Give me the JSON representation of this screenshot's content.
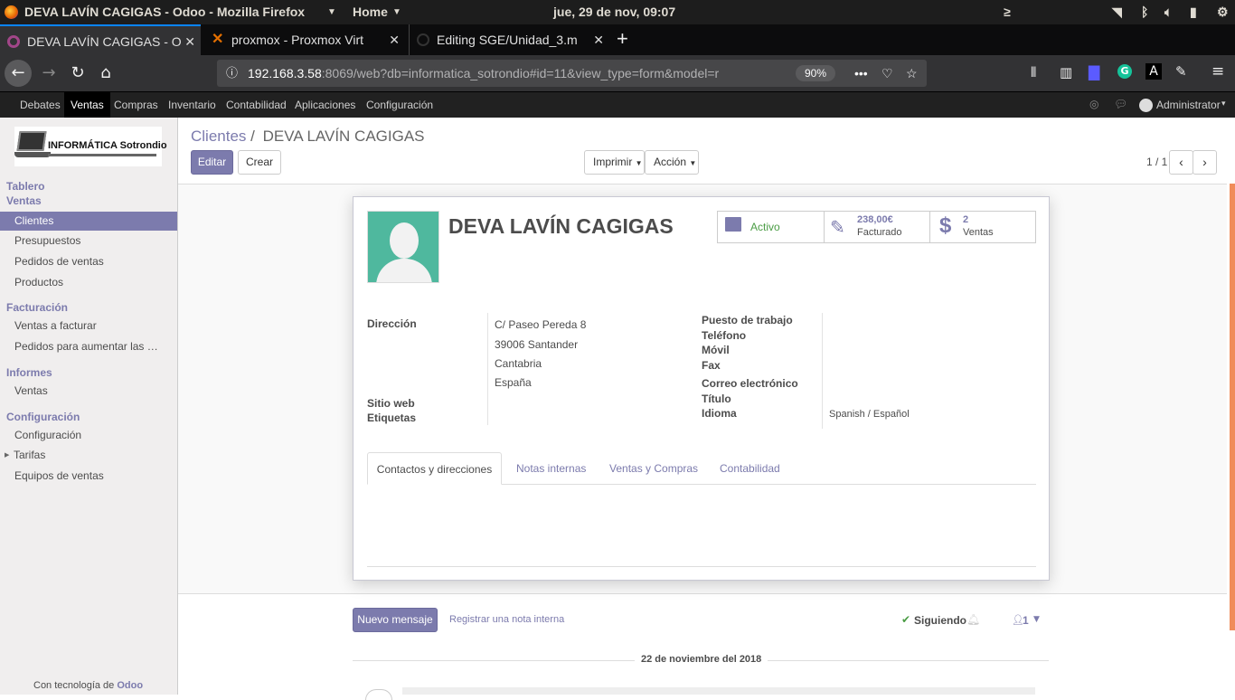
{
  "os_bar": {
    "window_title": "DEVA LAVÍN CAGIGAS - Odoo - Mozilla Firefox",
    "home": "Home",
    "clock": "jue, 29 de nov, 09:07"
  },
  "tabs": [
    {
      "title": "DEVA LAVÍN CAGIGAS - O"
    },
    {
      "title": "proxmox - Proxmox Virt"
    },
    {
      "title": "Editing SGE/Unidad_3.m"
    }
  ],
  "browser": {
    "url_host": "192.168.3.58",
    "url_rest": ":8069/web?db=informatica_sotrondio#id=11&view_type=form&model=r",
    "zoom": "90%"
  },
  "odoo_menu": {
    "items": [
      "Debates",
      "Ventas",
      "Compras",
      "Inventario",
      "Contabilidad",
      "Aplicaciones",
      "Configuración"
    ],
    "user": "Administrator"
  },
  "sidebar": {
    "logo_text": "INFORMÁTICA Sotrondio",
    "tablero": "Tablero",
    "ventas_header": "Ventas",
    "ventas_items": [
      "Clientes",
      "Presupuestos",
      "Pedidos de ventas",
      "Productos"
    ],
    "facturacion_header": "Facturación",
    "facturacion_items": [
      "Ventas a facturar",
      "Pedidos para aumentar las …"
    ],
    "informes_header": "Informes",
    "informes_items": [
      "Ventas"
    ],
    "config_header": "Configuración",
    "config_items": [
      "Configuración",
      "Tarifas",
      "Equipos de ventas"
    ],
    "powered_prefix": "Con tecnología de",
    "powered_brand": "Odoo"
  },
  "control": {
    "breadcrumb_parent": "Clientes",
    "breadcrumb_sep": "/",
    "breadcrumb_current": "DEVA LAVÍN CAGIGAS",
    "edit": "Editar",
    "create": "Crear",
    "print": "Imprimir",
    "action": "Acción",
    "pager": "1 / 1"
  },
  "record": {
    "name": "DEVA LAVÍN CAGIGAS",
    "stats": {
      "active": "Activo",
      "invoiced_value": "238,00€",
      "invoiced_label": "Facturado",
      "sales_value": "2",
      "sales_label": "Ventas"
    },
    "labels": {
      "address": "Dirección",
      "website": "Sitio web",
      "tags": "Etiquetas",
      "job": "Puesto de trabajo",
      "phone": "Teléfono",
      "mobile": "Móvil",
      "fax": "Fax",
      "email": "Correo electrónico",
      "title": "Título",
      "language": "Idioma"
    },
    "address_lines": [
      "C/ Paseo Pereda 8",
      "39006 Santander",
      "Cantabria",
      "España"
    ],
    "language": "Spanish / Español"
  },
  "notebook": {
    "tabs": [
      "Contactos y direcciones",
      "Notas internas",
      "Ventas y Compras",
      "Contabilidad"
    ]
  },
  "chatter": {
    "new_message": "Nuevo mensaje",
    "log_note": "Registrar una nota interna",
    "following": "Siguiendo",
    "followers_count": "1",
    "date_separator": "22 de noviembre del 2018"
  },
  "colors": {
    "odoo_primary": "#7c7bad",
    "avatar_bg": "#4fb89e",
    "topbar": "#1d1d1d"
  }
}
